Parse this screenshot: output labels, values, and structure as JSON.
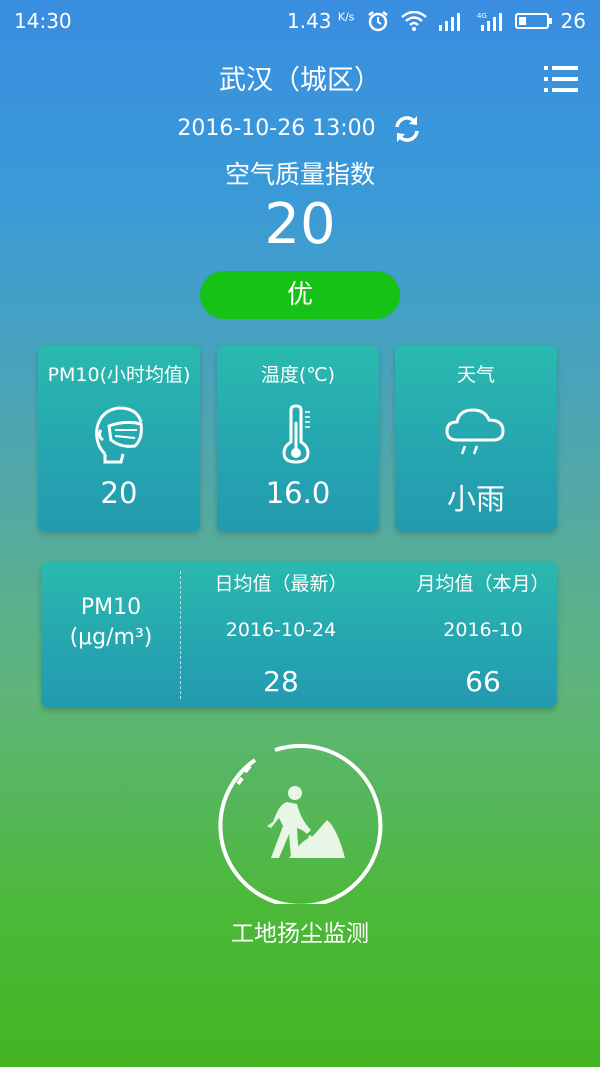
{
  "status_bar": {
    "time": "14:30",
    "net_speed": "1.43",
    "net_unit": "K/s",
    "battery": "26"
  },
  "header": {
    "city": "武汉（城区）",
    "datetime": "2016-10-26 13:00",
    "aqi_label": "空气质量指数",
    "aqi_value": "20",
    "aqi_level": "优",
    "level_color": "#16c216"
  },
  "cards": [
    {
      "title": "PM10(小时均值)",
      "value": "20",
      "icon": "mask-icon"
    },
    {
      "title": "温度(℃)",
      "value": "16.0",
      "icon": "thermometer-icon"
    },
    {
      "title": "天气",
      "value": "小雨",
      "icon": "light-rain-icon"
    }
  ],
  "pm_panel": {
    "label_line1": "PM10",
    "label_line2": "(μg/m³)",
    "daily": {
      "header": "日均值（最新）",
      "date": "2016-10-24",
      "value": "28"
    },
    "monthly": {
      "header": "月均值（本月）",
      "date": "2016-10",
      "value": "66"
    }
  },
  "site": {
    "label": "工地扬尘监测",
    "icon": "construction-worker-icon"
  }
}
